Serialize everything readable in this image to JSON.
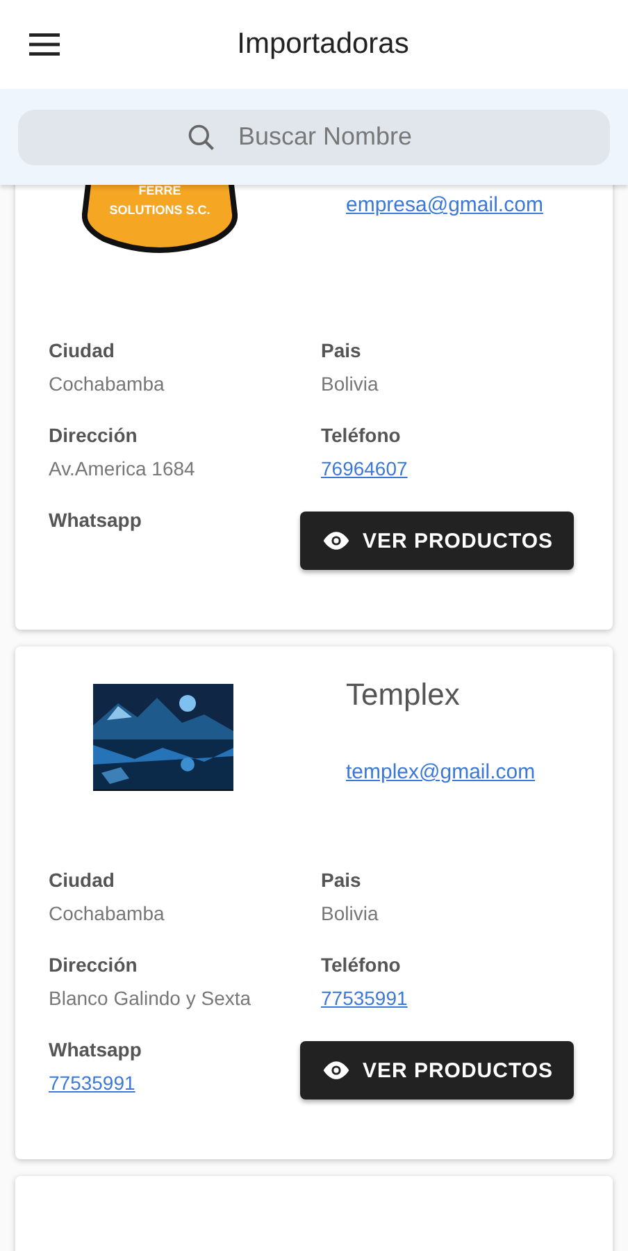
{
  "header": {
    "title": "Importadoras"
  },
  "search": {
    "placeholder": "Buscar Nombre"
  },
  "cards": [
    {
      "kind": "importer",
      "image": {
        "kind": "logo",
        "lines": [
          "FERRE",
          "SOLUTIONS S.C."
        ]
      },
      "email": "empresa@gmail.com",
      "fields": [
        {
          "label": "Ciudad",
          "value": "Cochabamba",
          "kind": "text"
        },
        {
          "label": "Pais",
          "value": "Bolivia",
          "kind": "text"
        },
        {
          "label": "Dirección",
          "value": "Av.America 1684",
          "kind": "text"
        },
        {
          "label": "Teléfono",
          "value": "76964607",
          "kind": "link"
        },
        {
          "label": "Whatsapp"
        }
      ],
      "button": "VER PRODUCTOS"
    },
    {
      "kind": "importer",
      "name": "Templex",
      "email": "templex@gmail.com",
      "fields": [
        {
          "label": "Ciudad",
          "value": "Cochabamba",
          "kind": "text"
        },
        {
          "label": "Pais",
          "value": "Bolivia",
          "kind": "text"
        },
        {
          "label": "Dirección",
          "value": "Blanco Galindo y Sexta",
          "kind": "text"
        },
        {
          "label": "Teléfono",
          "value": "77535991",
          "kind": "link"
        },
        {
          "label": "Whatsapp",
          "value": "77535991",
          "kind": "link"
        }
      ],
      "button": "VER PRODUCTOS"
    },
    {
      "kind": "blank"
    }
  ]
}
